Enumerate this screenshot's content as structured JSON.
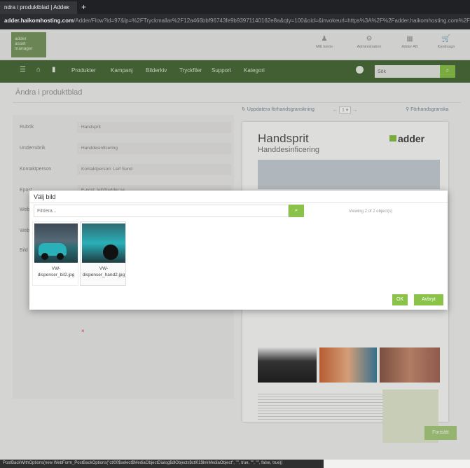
{
  "browser": {
    "tab_title": "ndra i produktblad | Adder",
    "tab_close": "×",
    "new_tab": "+",
    "url_host": "adder.haikomhosting.com",
    "url_path": "/Adder/Flow?id=97&lp=%2FTryckmallar%2F12a466bbf96743fe9b93971140162e8a&qty=100&oid=&invokeurl=https%3A%2F%2Fadder.haikomhosting.com%2F..."
  },
  "header": {
    "logo_lines": [
      "adder",
      "asset",
      "manager"
    ],
    "items": [
      {
        "label": "Mitt konto",
        "icon": "user-icon"
      },
      {
        "label": "Administration",
        "icon": "gears-icon"
      },
      {
        "label": "Adder AB",
        "icon": "building-icon"
      },
      {
        "label": "Kundvagn",
        "icon": "cart-icon"
      }
    ]
  },
  "nav": {
    "links": [
      "Produkter",
      "Kampanj",
      "Bilderkiv",
      "Tryckfiler",
      "Support",
      "Kategori"
    ],
    "search_placeholder": "Sök",
    "search_button": "⌕"
  },
  "page": {
    "title": "Ändra i produktblad",
    "update_preview": "Uppdatera förhandsgranskning",
    "pager_prev": "←",
    "pager_value": "1 ▾",
    "pager_next": "→",
    "preview_link": "Förhandsgranska",
    "fields": [
      {
        "label": "Rubrik",
        "value": "Handsprit"
      },
      {
        "label": "Underrubrik",
        "value": "Handdesinficering"
      },
      {
        "label": "Kontaktperson",
        "value": "Kontaktperson: Leif Sund"
      },
      {
        "label": "Epost",
        "value": "E-post: leif@adder.se"
      },
      {
        "label": "Web",
        "value": ""
      },
      {
        "label": "Web",
        "value": ""
      },
      {
        "label": "Bild",
        "value": ""
      }
    ],
    "remove_mark": "×",
    "save_button": "Fortsätt"
  },
  "preview_doc": {
    "title": "Handsprit",
    "subtitle": "Handdesinficering",
    "logo": "adder"
  },
  "modal": {
    "title": "Välj bild",
    "filter_placeholder": "Filtrera...",
    "filter_button": "⌕",
    "viewing": "Viewing 2 of 2 object(s)",
    "images": [
      {
        "filename": "VW-dispenser_bil2.jpg"
      },
      {
        "filename": "VW-dispenser_hand2.jpg"
      }
    ],
    "ok": "OK",
    "cancel": "Avbryt"
  },
  "status_bar": "PostBackWithOptions(new WebForm_PostBackOptions(\"ctl00$select$MediaObjectDialog$dlObjects$ctl01$lnkMediaObject\", \"\", true, \"\", \"\", false, true))"
}
